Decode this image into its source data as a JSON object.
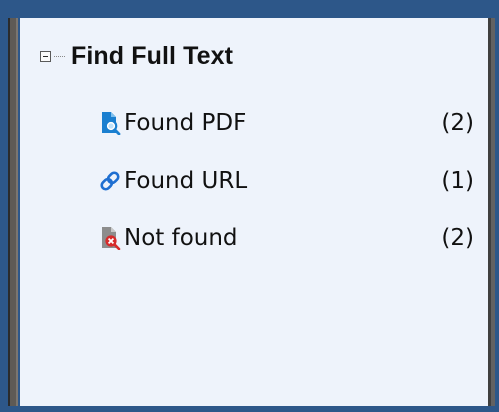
{
  "tree": {
    "root_label": "Find Full Text",
    "items": [
      {
        "label": "Found PDF",
        "count": "(2)",
        "icon": "document-search-icon"
      },
      {
        "label": "Found URL",
        "count": "(1)",
        "icon": "link-icon"
      },
      {
        "label": "Not found",
        "count": "(2)",
        "icon": "document-not-found-icon"
      }
    ]
  },
  "colors": {
    "frame": "#2d5789",
    "panel": "#eef3fb",
    "pdf_icon_blue": "#1a7fd0",
    "link_icon_blue": "#1f6fd1",
    "not_found_red": "#d72b2b",
    "doc_gray": "#8d8d8d"
  }
}
